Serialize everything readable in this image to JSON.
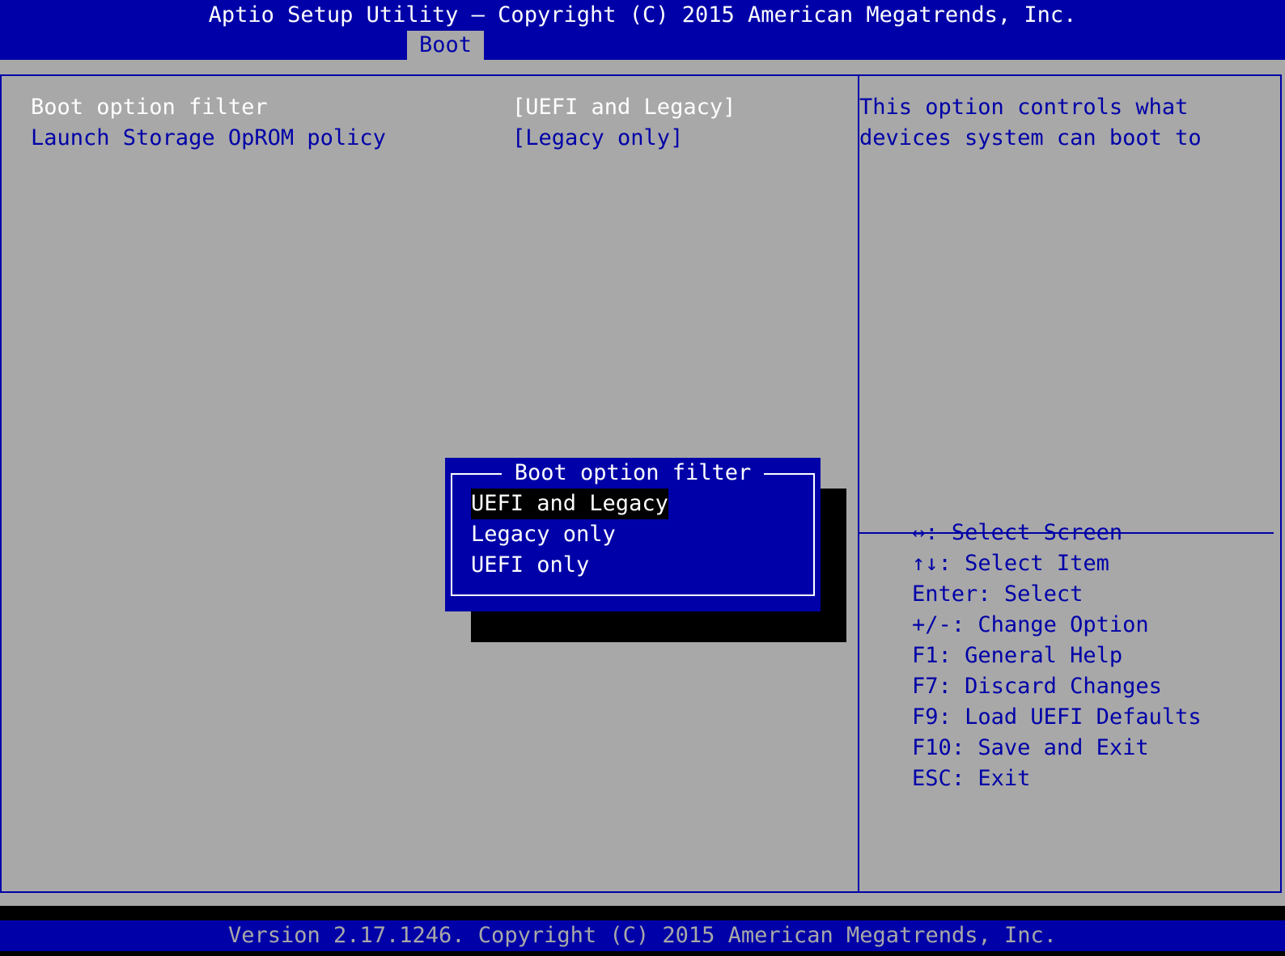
{
  "header": {
    "title": "Aptio Setup Utility – Copyright (C) 2015 American Megatrends, Inc.",
    "active_tab": "Boot"
  },
  "settings": [
    {
      "label": "Boot option filter",
      "value": "[UEFI and Legacy]"
    },
    {
      "label": "Launch Storage OpROM policy",
      "value": "[Legacy only]"
    }
  ],
  "help": {
    "lines": [
      "This option controls what",
      "devices system can boot to"
    ]
  },
  "keys": [
    {
      "key": "↔",
      "sep": ": ",
      "desc": "Select Screen"
    },
    {
      "key": "↑↓",
      "sep": ": ",
      "desc": "Select Item"
    },
    {
      "key": "Enter",
      "sep": ": ",
      "desc": "Select"
    },
    {
      "key": "+/-",
      "sep": ": ",
      "desc": "Change Option"
    },
    {
      "key": "F1",
      "sep": ": ",
      "desc": "General Help"
    },
    {
      "key": "F7",
      "sep": ": ",
      "desc": "Discard Changes"
    },
    {
      "key": "F9",
      "sep": ": ",
      "desc": "Load UEFI Defaults"
    },
    {
      "key": "F10",
      "sep": ": ",
      "desc": "Save and Exit"
    },
    {
      "key": "ESC",
      "sep": ": ",
      "desc": "Exit"
    }
  ],
  "popup": {
    "title": "Boot option filter",
    "options": [
      "UEFI and Legacy",
      "Legacy only",
      "UEFI only"
    ],
    "selected_index": 0
  },
  "footer": {
    "text": "Version 2.17.1246. Copyright (C) 2015 American Megatrends, Inc."
  },
  "colors": {
    "bios_blue": "#0000a8",
    "bios_gray": "#a8a8a8",
    "white": "#ffffff",
    "black": "#000000"
  }
}
